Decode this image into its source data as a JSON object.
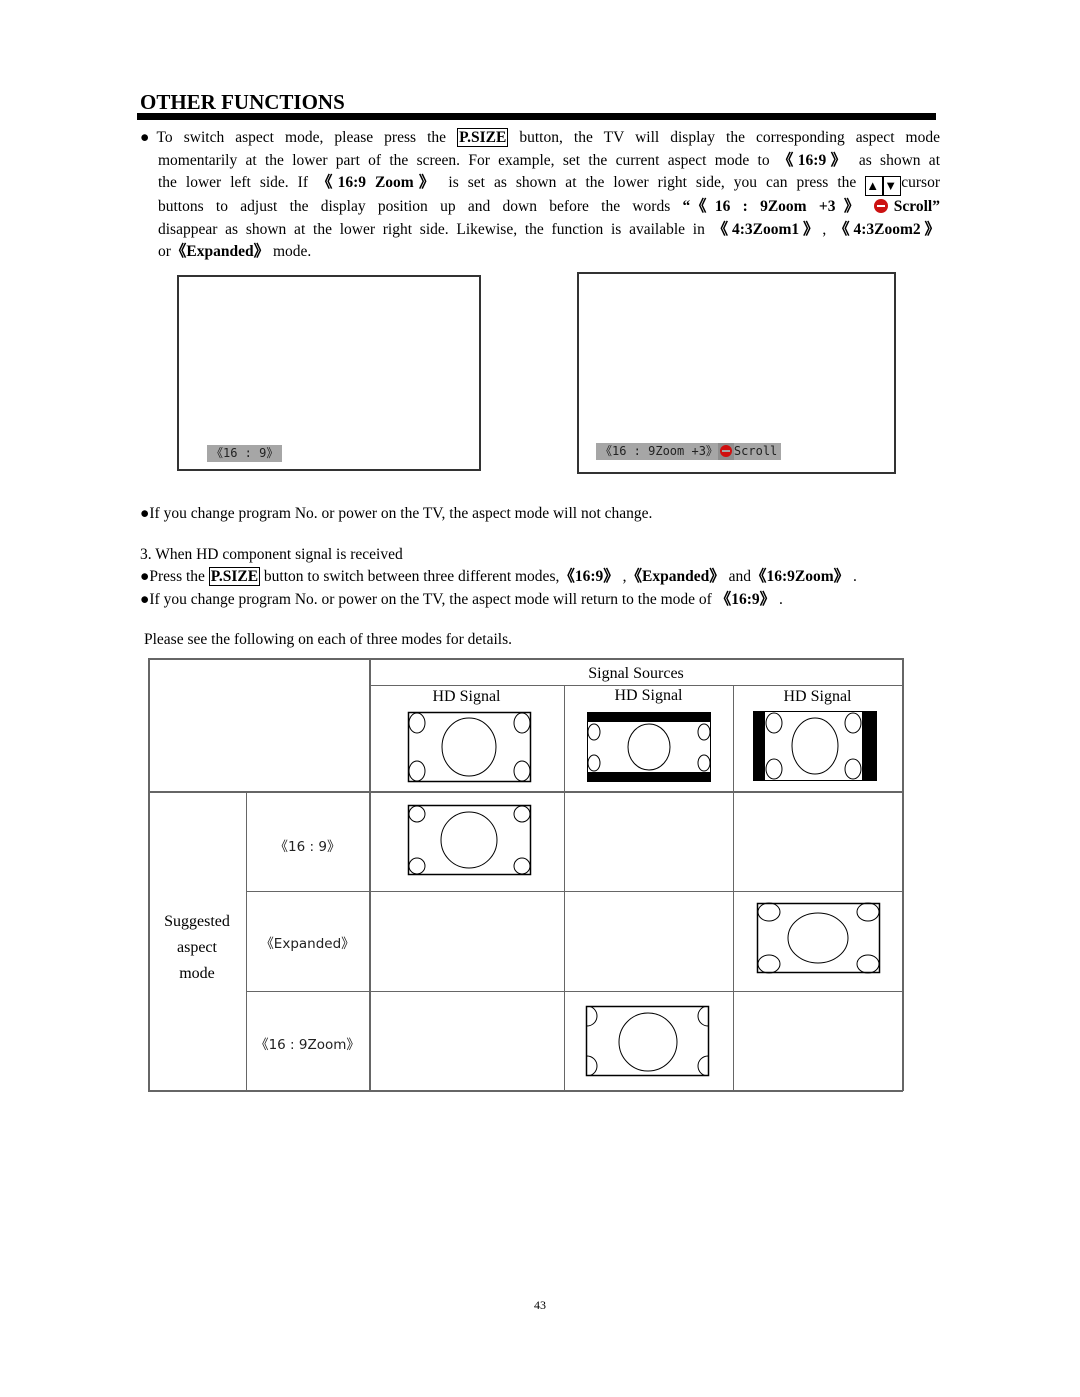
{
  "page": {
    "title": "OTHER FUNCTIONS",
    "page_number": "43"
  },
  "intro": {
    "line1_pre": "To switch aspect mode, please press the ",
    "psize": "P.SIZE",
    "line1_post": " button, the TV will display the corresponding aspect mode momentarily at the lower part of the screen. For example, set the current aspect mode to ",
    "mode_169": "《16:9》",
    "line2_post": " as shown at the lower left side. If ",
    "mode_169zoom": "《16:9 Zoom》",
    "line3_mid": " is set as shown at the lower right side, you can press the ",
    "up_arrow": "▲",
    "down_arrow": "▼",
    "line3_post": "cursor buttons to adjust the display position up and down before the words ",
    "quote_open": "“《16 : 9Zoom +3》",
    "scroll_word": "Scroll”",
    "line5_pre": " disappear as shown at the lower right side. Likewise, the function is available in ",
    "mode_43z1": "《4:3Zoom1》",
    "comma": ", ",
    "mode_43z2": "《4:3Zoom2》",
    "or": " or",
    "mode_expanded": "《Expanded》",
    "mode_word": " mode."
  },
  "screens": {
    "left_osd": "《16 : 9》",
    "right_osd_text": "《16 : 9Zoom +3》",
    "right_osd_scroll": "Scroll",
    "scroll_icon": "up-down-scroll-icon"
  },
  "notes": {
    "no_change": "If you change program No. or power on the TV, the aspect mode will not change.",
    "hd_heading": "3. When HD component signal is received",
    "press_pre": "Press the ",
    "psize": "P.SIZE",
    "press_post": " button to switch between three different modes,",
    "m1": "《16:9》",
    "sep1": " ,",
    "m2": "《Expanded》",
    "and": " and",
    "m3": "《16:9Zoom》",
    "period": " .",
    "return_pre": "If you change program No. or power on the TV, the aspect mode will return to the mode of ",
    "return_mode": "《16:9》",
    "return_post": " .",
    "see_following": "Please see the following on each of three modes for details."
  },
  "table": {
    "signal_sources": "Signal Sources",
    "columns": [
      {
        "label": "HD Signal",
        "picture": "full-16x9"
      },
      {
        "label": "HD Signal",
        "picture": "letterbox"
      },
      {
        "label": "HD Signal",
        "picture": "pillarbox"
      }
    ],
    "row_group_label": [
      "Suggested",
      "aspect",
      "mode"
    ],
    "rows": [
      {
        "mode": "《16 : 9》",
        "match_column": 1,
        "result": "full-16x9"
      },
      {
        "mode": "《Expanded》",
        "match_column": 3,
        "result": "expanded-stretch"
      },
      {
        "mode": "《16 : 9Zoom》",
        "match_column": 2,
        "result": "zoom-cropped"
      }
    ]
  }
}
